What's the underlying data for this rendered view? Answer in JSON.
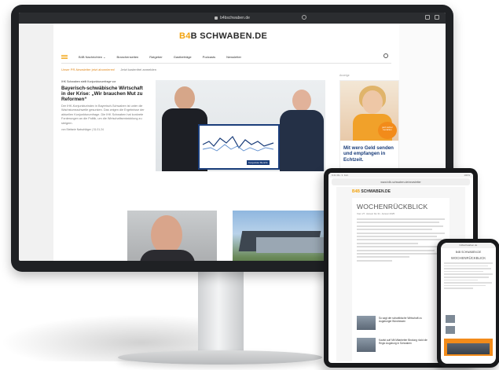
{
  "desktop": {
    "browser": {
      "url": "b4bschwaben.de"
    },
    "logo": {
      "prefix": "B",
      "mid": "4",
      "suffix": "B SCHWABEN.DE"
    },
    "nav": {
      "items": [
        "B4B Nachrichten ⌄",
        "Branchenseiten",
        "Ratgeber",
        "Gastbeiträge",
        "Podcasts",
        "Newsletter"
      ]
    },
    "promo": {
      "link": "Unser PR-Newsletter jetzt abonnieren!",
      "note": "Jetzt kostenfrei anmelden"
    },
    "article": {
      "kicker": "IHK Schwaben stellt Konjunkturumfrage vor",
      "headline": "Bayerisch-schwäbische Wirtschaft in der Krise: „Wir brauchen Mut zu Reformen“",
      "teaser": "Der IHK-Konjunkturindex in Bayerisch-Schwaben ist unter die Wachstumsschwelle gesunken. Das zeigen die Ergebnisse der aktuellen Konjunkturumfrage. Die IHK Schwaben hat konkrete Forderungen an die Politik, um die Wirtschaftsentwicklung zu steigern.",
      "meta": "von Stefanie Natschläger | 31.01.24"
    },
    "hero_sign_caption": "Konjunktur Bericht",
    "ad": {
      "label": "Anzeige",
      "badge": "jetzt sicher bezahlen",
      "text": "Mit wero Geld senden und empfangen in Echtzeit."
    }
  },
  "tablet": {
    "status_left": "9:41 Mo. 3. Feb.",
    "status_right": "100%",
    "url": "www.b4b-schwaben.de/newsletter",
    "logo_prefix": "B4B",
    "logo_suffix": " SCHWABEN.DE",
    "title": "WOCHENRÜCKBLICK",
    "date": "Vom 27. Januar bis 31. Januar 2025",
    "rows": [
      {
        "text": "So sagt der schwäbische Wirtschaft zu Augsburger Bündnissen"
      },
      {
        "text": "Kaufst auf! Mit Mitarbeiter Bindung rückt die Regio Augsburg in Schwaben"
      }
    ]
  },
  "phone": {
    "url": "b4bschwaben.de",
    "logo": "B4B SCHWABEN.DE",
    "title": "WOCHENRÜCKBLICK"
  },
  "colors": {
    "brand_orange": "#f2a30f",
    "ad_blue": "#1a3d7a",
    "bezel": "#1f2124"
  }
}
